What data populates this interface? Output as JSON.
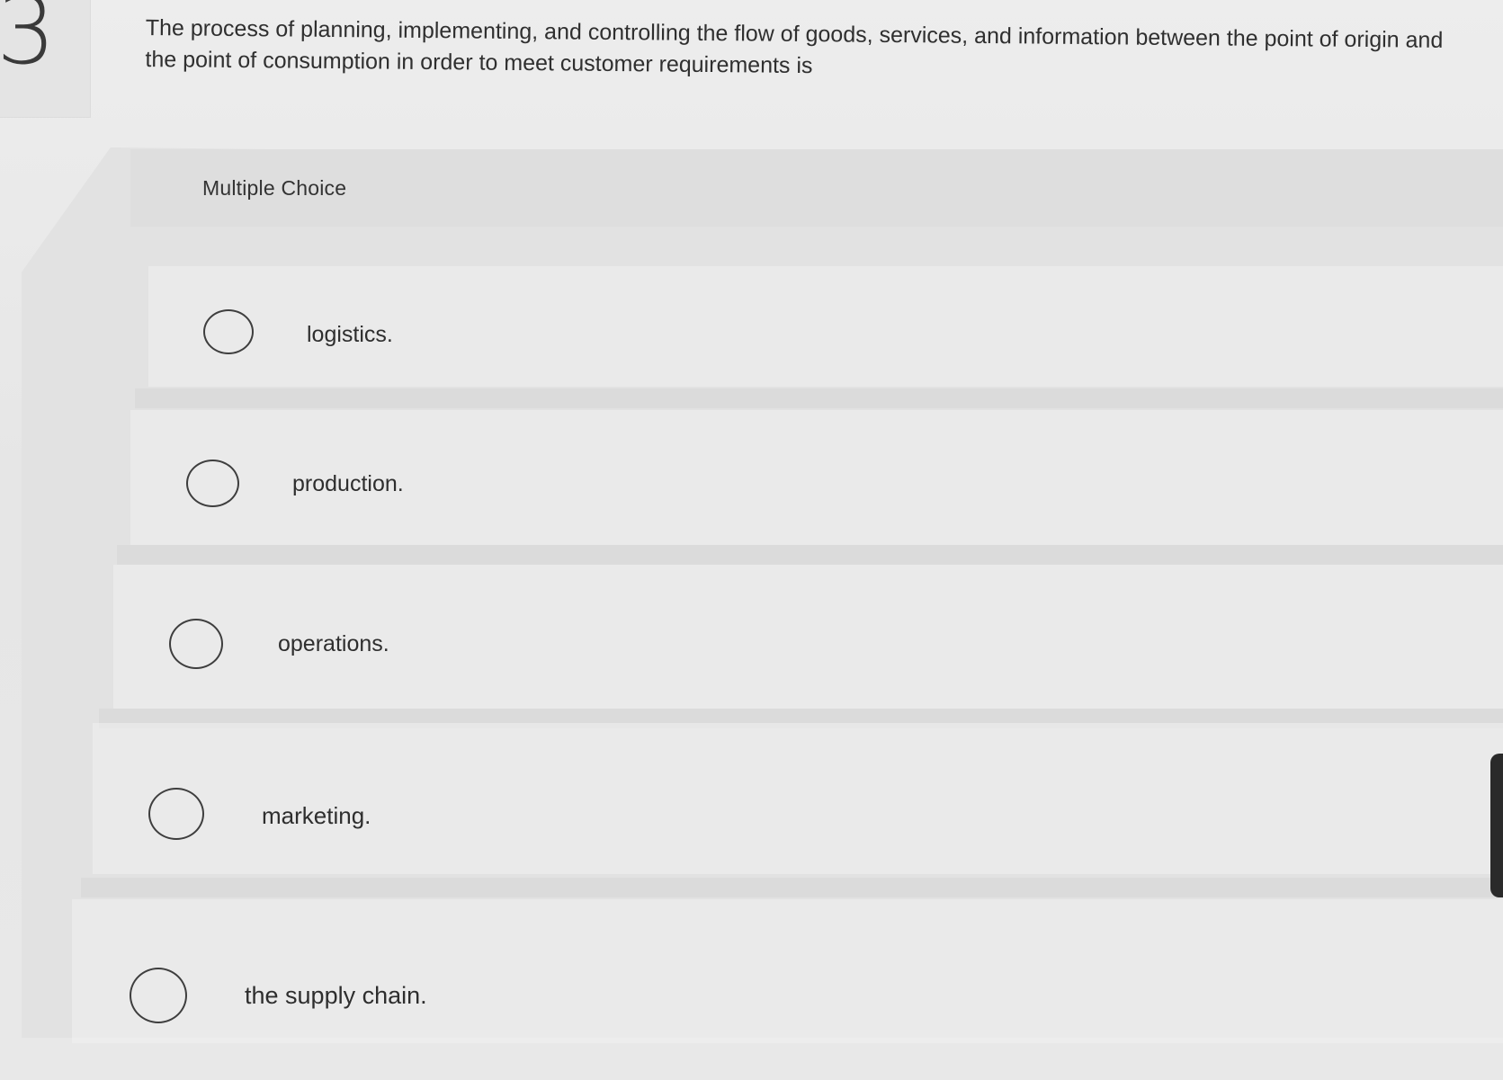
{
  "question": {
    "number": "3",
    "text": "The process of planning, implementing, and controlling the flow of goods, services, and information between the point of origin and the point of consumption in order to meet customer requirements is"
  },
  "answer_section": {
    "type_label": "Multiple Choice",
    "options": [
      {
        "label": "logistics.",
        "selected": false
      },
      {
        "label": "production.",
        "selected": false
      },
      {
        "label": "operations.",
        "selected": false
      },
      {
        "label": "marketing.",
        "selected": false
      },
      {
        "label": "the supply chain.",
        "selected": false
      }
    ]
  },
  "colors": {
    "background": "#e9e9e9",
    "text": "#2f2f2f",
    "radio_border": "#3e3e3e"
  }
}
